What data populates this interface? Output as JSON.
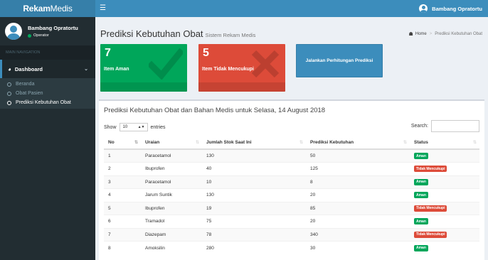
{
  "brand": {
    "logo_bold": "Rekam",
    "logo_light": "Medis"
  },
  "user": {
    "name": "Bambang Opratortu",
    "role": "Operator"
  },
  "sidebar": {
    "nav_header": "MAIN NAVIGATION",
    "dashboard": "Dashboard",
    "items": [
      {
        "label": "Beranda"
      },
      {
        "label": "Obat Pasien"
      },
      {
        "label": "Prediksi Kebutuhan Obat"
      }
    ]
  },
  "header": {
    "menu_icon": "hamburger-icon",
    "user_name": "Bambang Opratortu"
  },
  "page": {
    "title": "Prediksi Kebutuhan Obat",
    "subtitle": "Sistem Rekam Medis",
    "breadcrumb_home": "Home",
    "breadcrumb_current": "Prediksi Kebutuhan Obat"
  },
  "stats": {
    "safe": {
      "value": "7",
      "label": "Item Aman",
      "color": "#00a65a",
      "icon": "check-icon"
    },
    "short": {
      "value": "5",
      "label": "Item Tidak Mencukupi",
      "color": "#dd4b39",
      "icon": "x-icon"
    },
    "run_button": "Jalankan Perhitungan Prediksi"
  },
  "panel": {
    "title": "Prediksi Kebutuhan Obat dan Bahan Medis untuk Selasa, 14 August 2018",
    "show_label": "Show",
    "entries_value": "10",
    "entries_label": "entries",
    "search_label": "Search:"
  },
  "table": {
    "headers": [
      "No",
      "Uraian",
      "Jumlah Stok Saat Ini",
      "Prediksi Kebutuhan",
      "Status"
    ],
    "rows": [
      [
        "1",
        "Paracetamol",
        "130",
        "50",
        "Aman"
      ],
      [
        "2",
        "Ibuprofen",
        "40",
        "125",
        "Tidak Mencukupi"
      ],
      [
        "3",
        "Paracetamol",
        "10",
        "8",
        "Aman"
      ],
      [
        "4",
        "Jarum Suntik",
        "130",
        "20",
        "Aman"
      ],
      [
        "5",
        "Ibuprofen",
        "19",
        "85",
        "Tidak Mencukupi"
      ],
      [
        "6",
        "Tramadol",
        "75",
        "20",
        "Aman"
      ],
      [
        "7",
        "Diazepam",
        "78",
        "340",
        "Tidak Mencukupi"
      ],
      [
        "8",
        "Amoksilin",
        "280",
        "30",
        "Aman"
      ]
    ]
  },
  "colors": {
    "primary": "#3c8dbc",
    "sidebar": "#222d32",
    "success": "#00a65a",
    "danger": "#dd4b39"
  }
}
